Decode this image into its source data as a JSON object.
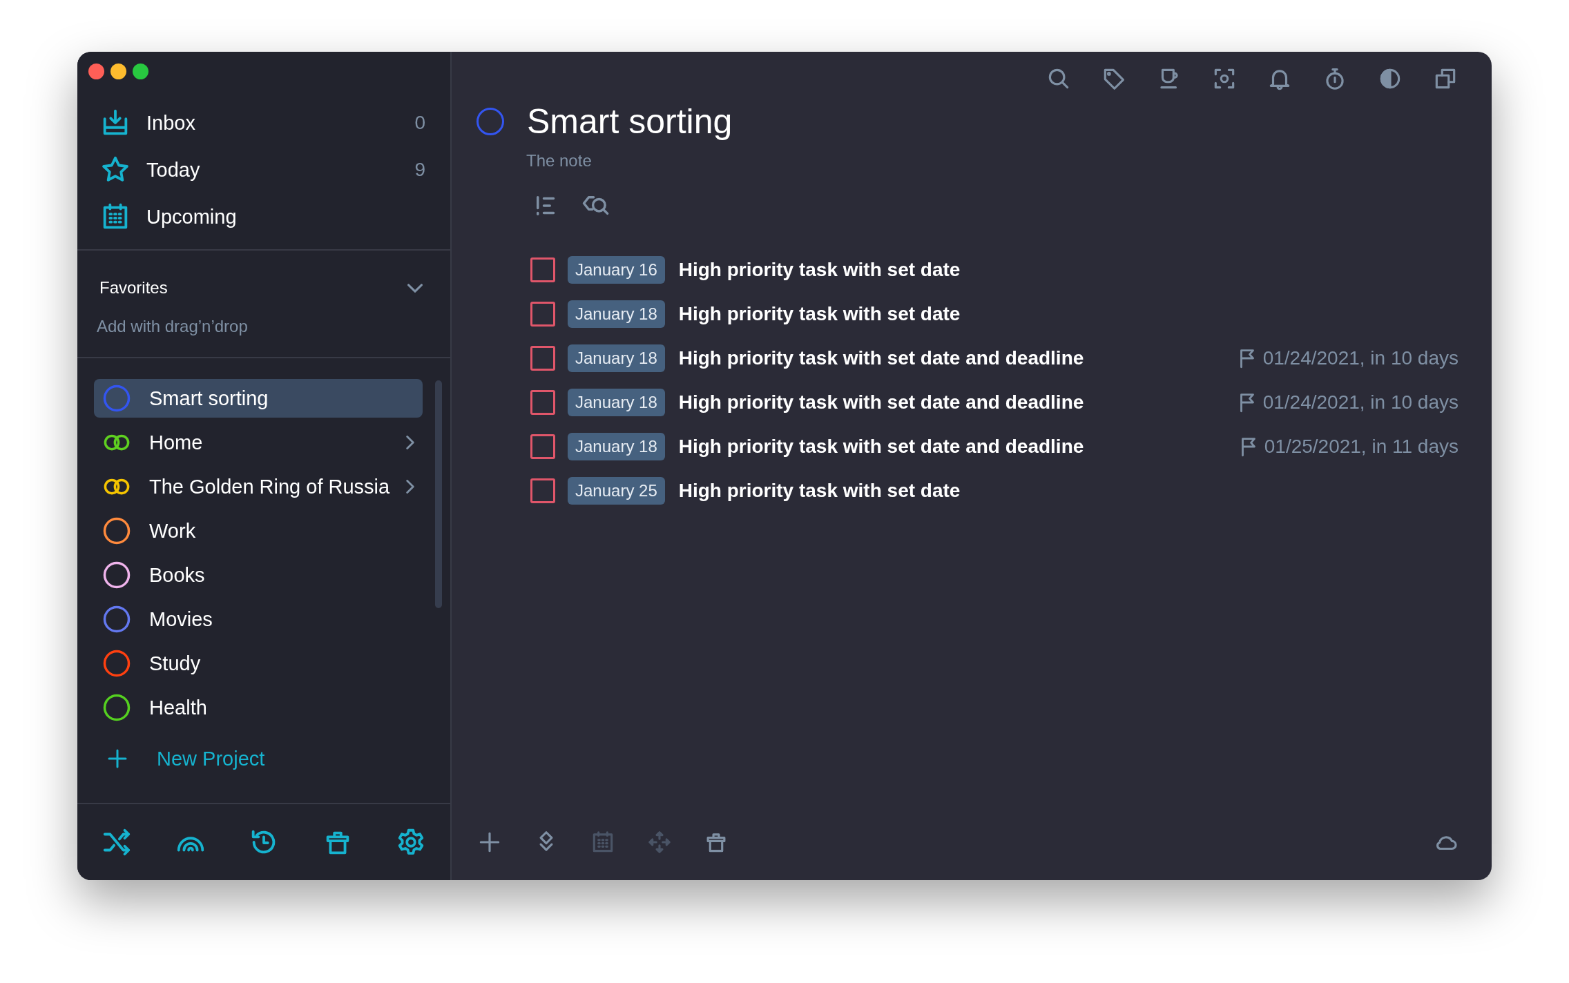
{
  "window": {
    "controls": [
      {
        "kind": "close"
      },
      {
        "kind": "minimize"
      },
      {
        "kind": "zoom"
      }
    ]
  },
  "sidebar": {
    "nav": [
      {
        "kind": "inbox",
        "label": "Inbox",
        "count": "0"
      },
      {
        "kind": "today",
        "label": "Today",
        "count": "9"
      },
      {
        "kind": "upcoming",
        "label": "Upcoming"
      }
    ],
    "favorites": {
      "title": "Favorites",
      "expanded": true,
      "hint": "Add with drag’n’drop"
    },
    "projects": [
      {
        "kind": "project",
        "label": "Smart sorting",
        "color": "#3355f0",
        "selected": true
      },
      {
        "kind": "folder",
        "label": "Home",
        "color": "#5fd020",
        "selected": false
      },
      {
        "kind": "folder",
        "label": "The Golden Ring of Russia",
        "color": "#f5c400",
        "selected": false
      },
      {
        "kind": "project",
        "label": "Work",
        "color": "#ff8a3d",
        "selected": false
      },
      {
        "kind": "project",
        "label": "Books",
        "color": "#f0b4ec",
        "selected": false
      },
      {
        "kind": "project",
        "label": "Movies",
        "color": "#6378f0",
        "selected": false
      },
      {
        "kind": "project",
        "label": "Study",
        "color": "#ff4010",
        "selected": false
      },
      {
        "kind": "project",
        "label": "Health",
        "color": "#55d020",
        "selected": false
      }
    ],
    "new_project": "New Project",
    "toolbar": [
      {
        "kind": "shuffle"
      },
      {
        "kind": "rainbow"
      },
      {
        "kind": "history"
      },
      {
        "kind": "trash"
      },
      {
        "kind": "settings"
      }
    ]
  },
  "main": {
    "toolbar": [
      {
        "kind": "search"
      },
      {
        "kind": "tag"
      },
      {
        "kind": "coffee"
      },
      {
        "kind": "focus"
      },
      {
        "kind": "bell"
      },
      {
        "kind": "timer"
      },
      {
        "kind": "contrast"
      },
      {
        "kind": "copy"
      }
    ],
    "project": {
      "title": "Smart sorting",
      "color": "#3355f0",
      "note_placeholder": "The note"
    },
    "filters": [
      {
        "kind": "priority"
      },
      {
        "kind": "tag-search"
      }
    ],
    "tasks": [
      {
        "checked": false,
        "date": "January 16",
        "title": "High priority task with set date"
      },
      {
        "checked": false,
        "date": "January 18",
        "title": "High priority task with set date"
      },
      {
        "checked": false,
        "date": "January 18",
        "title": "High priority task with set date and deadline",
        "deadline": "01/24/2021, in 10 days"
      },
      {
        "checked": false,
        "date": "January 18",
        "title": "High priority task with set date and deadline",
        "deadline": "01/24/2021, in 10 days"
      },
      {
        "checked": false,
        "date": "January 18",
        "title": "High priority task with set date and deadline",
        "deadline": "01/25/2021, in 11 days"
      },
      {
        "checked": false,
        "date": "January 25",
        "title": "High priority task with set date"
      }
    ],
    "bottom_toolbar": [
      {
        "kind": "add",
        "disabled": false
      },
      {
        "kind": "layers",
        "disabled": false
      },
      {
        "kind": "calendar",
        "disabled": true
      },
      {
        "kind": "move",
        "disabled": true
      },
      {
        "kind": "trash",
        "disabled": false
      }
    ],
    "sync": {
      "kind": "cloud"
    }
  }
}
